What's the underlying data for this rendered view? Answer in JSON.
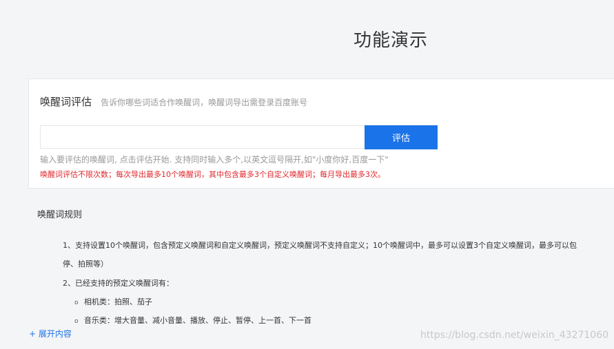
{
  "page": {
    "title": "功能演示"
  },
  "evaluator": {
    "title": "唤醒词评估",
    "subtitle": "告诉你哪些词适合作唤醒词，唤醒词导出需登录百度账号",
    "input_value": "",
    "input_placeholder": "",
    "button_label": "评估",
    "hint": "输入要评估的唤醒词, 点击评估开始. 支持同时输入多个,以英文逗号隔开,如\"小度你好,百度一下\"",
    "limit_notice": "唤醒词评估不限次数；每次导出最多10个唤醒词，其中包含最多3个自定义唤醒词；每月导出最多3次。"
  },
  "rules": {
    "title": "唤醒词规则",
    "lines": [
      "1、支持设置10个唤醒词，包含预定义唤醒词和自定义唤醒词，预定义唤醒词不支持自定义；10个唤醒词中，最多可以设置3个自定义唤醒词，最多可以包",
      "停、拍照等）",
      "2、已经支持的预定义唤醒词有："
    ],
    "bullets": [
      "相机类：拍照、茄子",
      "音乐类：增大音量、减小音量、播放、停止、暂停、上一首、下一首"
    ],
    "bullet_glyph": "o",
    "expand_label": "+ 展开内容"
  },
  "watermark": "https://blog.csdn.net/weixin_43271060",
  "colors": {
    "accent": "#1a73e8",
    "warning": "#e0262c",
    "background": "#f4f5f7"
  }
}
